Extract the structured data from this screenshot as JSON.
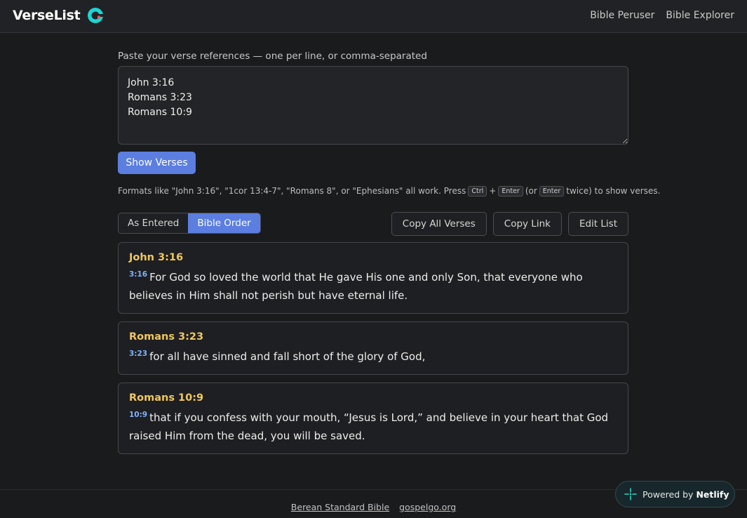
{
  "header": {
    "brand": "VerseList",
    "nav": [
      "Bible Peruser",
      "Bible Explorer"
    ]
  },
  "input": {
    "label": "Paste your verse references — one per line, or comma-separated",
    "value": "John 3:16\nRomans 3:23\nRomans 10:9",
    "show_button": "Show Verses"
  },
  "hint": {
    "prefix": "Formats like \"John 3:16\", \"1cor 13:4-7\", \"Romans 8\", or \"Ephesians\" all work. Press",
    "key_ctrl": "Ctrl",
    "plus": "+",
    "key_enter": "Enter",
    "middle": "(or",
    "key_enter2": "Enter",
    "suffix": "twice) to show verses."
  },
  "order_toggle": {
    "as_entered": "As Entered",
    "bible_order": "Bible Order",
    "selected": "Bible Order"
  },
  "actions": {
    "copy_all": "Copy All Verses",
    "copy_link": "Copy Link",
    "edit_list": "Edit List"
  },
  "verses": [
    {
      "ref": "John 3:16",
      "num": "3:16",
      "text": "For God so loved the world that He gave His one and only Son, that everyone who believes in Him shall not perish but have eternal life."
    },
    {
      "ref": "Romans 3:23",
      "num": "3:23",
      "text": "for all have sinned and fall short of the glory of God,"
    },
    {
      "ref": "Romans 10:9",
      "num": "10:9",
      "text": "that if you confess with your mouth, “Jesus is Lord,” and believe in your heart that God raised Him from the dead, you will be saved."
    }
  ],
  "footer": {
    "links": [
      "Berean Standard Bible",
      "gospelgo.org"
    ]
  },
  "badge": {
    "prefix": "Powered by",
    "brand": "Netlify"
  },
  "colors": {
    "accent": "#5b7ee0",
    "reference": "#f0c75e",
    "verse_number": "#7fb3ff",
    "logo": "#1ed4d4"
  }
}
